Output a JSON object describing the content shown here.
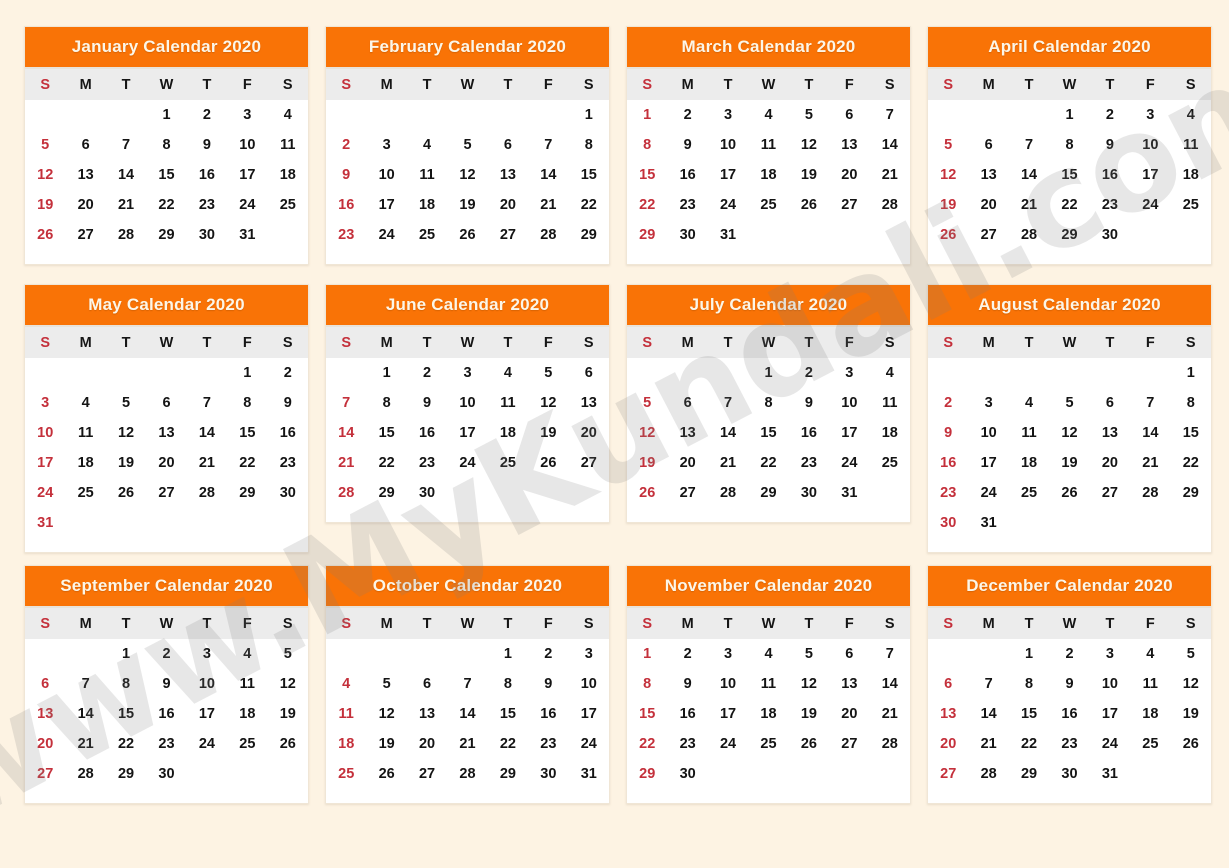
{
  "page": {
    "year": "2020",
    "background_color": "#FDF3E3",
    "accent_color": "#F97306",
    "sunday_color": "#C4303B",
    "weekday_header_bg": "#ECECEC",
    "card_bg": "#FFFFFF"
  },
  "watermark": {
    "text": "www.MyKundali.com"
  },
  "weekday_headers": [
    "S",
    "M",
    "T",
    "W",
    "T",
    "F",
    "S"
  ],
  "months": [
    {
      "title": "January Calendar 2020",
      "name": "January",
      "weeks": [
        [
          "",
          "",
          "",
          "1",
          "2",
          "3",
          "4"
        ],
        [
          "5",
          "6",
          "7",
          "8",
          "9",
          "10",
          "11"
        ],
        [
          "12",
          "13",
          "14",
          "15",
          "16",
          "17",
          "18"
        ],
        [
          "19",
          "20",
          "21",
          "22",
          "23",
          "24",
          "25"
        ],
        [
          "26",
          "27",
          "28",
          "29",
          "30",
          "31",
          ""
        ]
      ]
    },
    {
      "title": "February Calendar 2020",
      "name": "February",
      "weeks": [
        [
          "",
          "",
          "",
          "",
          "",
          "",
          "1"
        ],
        [
          "2",
          "3",
          "4",
          "5",
          "6",
          "7",
          "8"
        ],
        [
          "9",
          "10",
          "11",
          "12",
          "13",
          "14",
          "15"
        ],
        [
          "16",
          "17",
          "18",
          "19",
          "20",
          "21",
          "22"
        ],
        [
          "23",
          "24",
          "25",
          "26",
          "27",
          "28",
          "29"
        ]
      ]
    },
    {
      "title": "March Calendar 2020",
      "name": "March",
      "weeks": [
        [
          "1",
          "2",
          "3",
          "4",
          "5",
          "6",
          "7"
        ],
        [
          "8",
          "9",
          "10",
          "11",
          "12",
          "13",
          "14"
        ],
        [
          "15",
          "16",
          "17",
          "18",
          "19",
          "20",
          "21"
        ],
        [
          "22",
          "23",
          "24",
          "25",
          "26",
          "27",
          "28"
        ],
        [
          "29",
          "30",
          "31",
          "",
          "",
          "",
          ""
        ]
      ]
    },
    {
      "title": "April Calendar 2020",
      "name": "April",
      "weeks": [
        [
          "",
          "",
          "",
          "1",
          "2",
          "3",
          "4"
        ],
        [
          "5",
          "6",
          "7",
          "8",
          "9",
          "10",
          "11"
        ],
        [
          "12",
          "13",
          "14",
          "15",
          "16",
          "17",
          "18"
        ],
        [
          "19",
          "20",
          "21",
          "22",
          "23",
          "24",
          "25"
        ],
        [
          "26",
          "27",
          "28",
          "29",
          "30",
          "",
          ""
        ]
      ]
    },
    {
      "title": "May Calendar 2020",
      "name": "May",
      "weeks": [
        [
          "",
          "",
          "",
          "",
          "",
          "1",
          "2"
        ],
        [
          "3",
          "4",
          "5",
          "6",
          "7",
          "8",
          "9"
        ],
        [
          "10",
          "11",
          "12",
          "13",
          "14",
          "15",
          "16"
        ],
        [
          "17",
          "18",
          "19",
          "20",
          "21",
          "22",
          "23"
        ],
        [
          "24",
          "25",
          "26",
          "27",
          "28",
          "29",
          "30"
        ],
        [
          "31",
          "",
          "",
          "",
          "",
          "",
          ""
        ]
      ]
    },
    {
      "title": "June Calendar 2020",
      "name": "June",
      "weeks": [
        [
          "",
          "1",
          "2",
          "3",
          "4",
          "5",
          "6"
        ],
        [
          "7",
          "8",
          "9",
          "10",
          "11",
          "12",
          "13"
        ],
        [
          "14",
          "15",
          "16",
          "17",
          "18",
          "19",
          "20"
        ],
        [
          "21",
          "22",
          "23",
          "24",
          "25",
          "26",
          "27"
        ],
        [
          "28",
          "29",
          "30",
          "",
          "",
          "",
          ""
        ]
      ]
    },
    {
      "title": "July Calendar 2020",
      "name": "July",
      "weeks": [
        [
          "",
          "",
          "",
          "1",
          "2",
          "3",
          "4"
        ],
        [
          "5",
          "6",
          "7",
          "8",
          "9",
          "10",
          "11"
        ],
        [
          "12",
          "13",
          "14",
          "15",
          "16",
          "17",
          "18"
        ],
        [
          "19",
          "20",
          "21",
          "22",
          "23",
          "24",
          "25"
        ],
        [
          "26",
          "27",
          "28",
          "29",
          "30",
          "31",
          ""
        ]
      ]
    },
    {
      "title": "August Calendar 2020",
      "name": "August",
      "weeks": [
        [
          "",
          "",
          "",
          "",
          "",
          "",
          "1"
        ],
        [
          "2",
          "3",
          "4",
          "5",
          "6",
          "7",
          "8"
        ],
        [
          "9",
          "10",
          "11",
          "12",
          "13",
          "14",
          "15"
        ],
        [
          "16",
          "17",
          "18",
          "19",
          "20",
          "21",
          "22"
        ],
        [
          "23",
          "24",
          "25",
          "26",
          "27",
          "28",
          "29"
        ],
        [
          "30",
          "31",
          "",
          "",
          "",
          "",
          ""
        ]
      ]
    },
    {
      "title": "September Calendar 2020",
      "name": "September",
      "weeks": [
        [
          "",
          "",
          "1",
          "2",
          "3",
          "4",
          "5"
        ],
        [
          "6",
          "7",
          "8",
          "9",
          "10",
          "11",
          "12"
        ],
        [
          "13",
          "14",
          "15",
          "16",
          "17",
          "18",
          "19"
        ],
        [
          "20",
          "21",
          "22",
          "23",
          "24",
          "25",
          "26"
        ],
        [
          "27",
          "28",
          "29",
          "30",
          "",
          "",
          ""
        ]
      ]
    },
    {
      "title": "October Calendar 2020",
      "name": "October",
      "weeks": [
        [
          "",
          "",
          "",
          "",
          "1",
          "2",
          "3"
        ],
        [
          "4",
          "5",
          "6",
          "7",
          "8",
          "9",
          "10"
        ],
        [
          "11",
          "12",
          "13",
          "14",
          "15",
          "16",
          "17"
        ],
        [
          "18",
          "19",
          "20",
          "21",
          "22",
          "23",
          "24"
        ],
        [
          "25",
          "26",
          "27",
          "28",
          "29",
          "30",
          "31"
        ]
      ]
    },
    {
      "title": "November Calendar 2020",
      "name": "November",
      "weeks": [
        [
          "1",
          "2",
          "3",
          "4",
          "5",
          "6",
          "7"
        ],
        [
          "8",
          "9",
          "10",
          "11",
          "12",
          "13",
          "14"
        ],
        [
          "15",
          "16",
          "17",
          "18",
          "19",
          "20",
          "21"
        ],
        [
          "22",
          "23",
          "24",
          "25",
          "26",
          "27",
          "28"
        ],
        [
          "29",
          "30",
          "",
          "",
          "",
          "",
          ""
        ]
      ]
    },
    {
      "title": "December Calendar 2020",
      "name": "December",
      "weeks": [
        [
          "",
          "",
          "1",
          "2",
          "3",
          "4",
          "5"
        ],
        [
          "6",
          "7",
          "8",
          "9",
          "10",
          "11",
          "12"
        ],
        [
          "13",
          "14",
          "15",
          "16",
          "17",
          "18",
          "19"
        ],
        [
          "20",
          "21",
          "22",
          "23",
          "24",
          "25",
          "26"
        ],
        [
          "27",
          "28",
          "29",
          "30",
          "31",
          "",
          ""
        ]
      ]
    }
  ]
}
